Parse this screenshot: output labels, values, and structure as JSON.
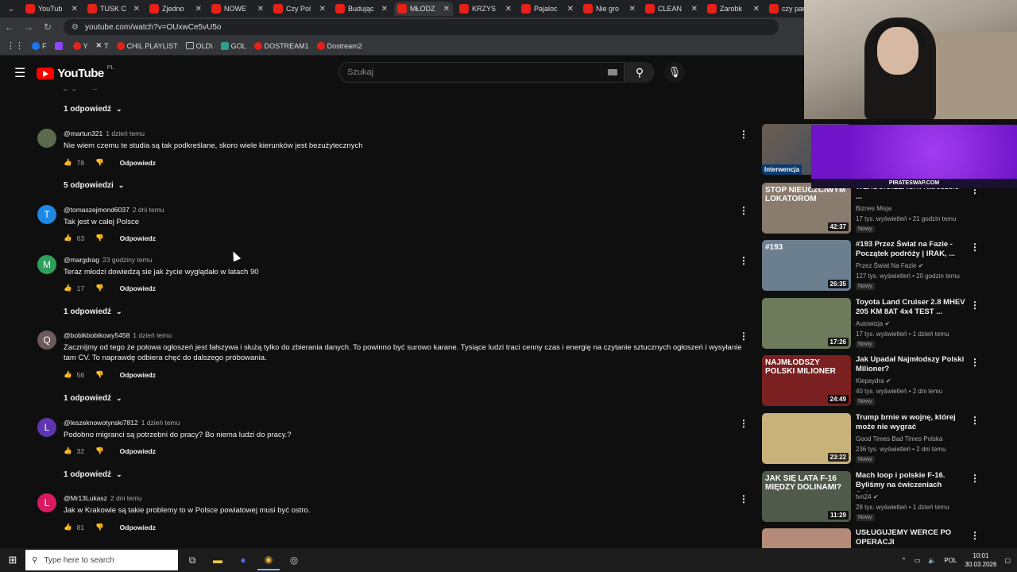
{
  "browser": {
    "tabs": [
      {
        "label": "YouTub",
        "active": false
      },
      {
        "label": "TUSK C",
        "active": false
      },
      {
        "label": "Zjedno",
        "active": false
      },
      {
        "label": "NOWE",
        "active": false
      },
      {
        "label": "Czy Pol",
        "active": false
      },
      {
        "label": "Budując",
        "active": false
      },
      {
        "label": "MŁODZ",
        "active": true
      },
      {
        "label": "KRZYS",
        "active": false
      },
      {
        "label": "Pajaloc",
        "active": false
      },
      {
        "label": "Nie gro",
        "active": false
      },
      {
        "label": "CLEAN",
        "active": false
      },
      {
        "label": "Zarobk",
        "active": false
      },
      {
        "label": "czy par",
        "active": false
      }
    ],
    "url": "youtube.com/watch?v=OUxwCe5vU5o",
    "bookmarks": [
      "F",
      "",
      "Y",
      "T",
      "CHIL PLAYLIST",
      "OLD\\",
      "GOL",
      "DOSTREAM1",
      "Dostream2"
    ]
  },
  "youtube": {
    "logo_text": "YouTube",
    "region": "PL",
    "search_placeholder": "Szukaj"
  },
  "comments": [
    {
      "replies_label": "1 odpowiedź"
    },
    {
      "initial": "",
      "avatar_color": "#5b6a4c",
      "author": "@martun321",
      "when": "1 dzień temu",
      "text": "Nie wiem czemu te studia są tak podkreślane, skoro wiele kierunków jest bezużytecznych",
      "likes": "78",
      "reply_label": "Odpowiedz",
      "replies_label": "5 odpowiedzi"
    },
    {
      "initial": "T",
      "avatar_color": "#1e88e5",
      "author": "@tomaszejmond6037",
      "when": "2 dni temu",
      "text": "Tak jest w całej Polsce",
      "likes": "63",
      "reply_label": "Odpowiedz",
      "replies_label": ""
    },
    {
      "initial": "M",
      "avatar_color": "#2e9e5b",
      "author": "@margdrag",
      "when": "23 godziny temu",
      "text": "Teraz młodzi dowiedzą sie jak życie wyglądało w latach 90",
      "likes": "17",
      "reply_label": "Odpowiedz",
      "replies_label": "1 odpowiedź"
    },
    {
      "initial": "Q",
      "avatar_color": "#6d5a5a",
      "author": "@bobikbobikowy5458",
      "when": "1 dzień temu",
      "text": "Zacznijmy od tego że połowa ogłoszeń jest fałszywa i służą tylko do zbierania danych. To powinno być surowo karane. Tysiące ludzi traci cenny czas i energię na czytanie sztucznych ogłoszeń i wysyłanie tam CV. To naprawdę odbiera chęć do dalszego próbowania.",
      "likes": "56",
      "reply_label": "Odpowiedz",
      "replies_label": "1 odpowiedź"
    },
    {
      "initial": "L",
      "avatar_color": "#5e35b1",
      "author": "@leszeknowotynski7812",
      "when": "1 dzień temu",
      "text": "Podobno migranci są potrzebni do pracy?  Bo niema ludzi do pracy.?",
      "likes": "32",
      "reply_label": "Odpowiedz",
      "replies_label": "1 odpowiedź"
    },
    {
      "initial": "L",
      "avatar_color": "#d81b60",
      "author": "@Mr13Lukasz",
      "when": "2 dni temu",
      "text": "Jak w Krakowie są takie problemy to w Polsce powiatowej musi być ostro.",
      "likes": "81",
      "reply_label": "Odpowiedz",
      "replies_label": ""
    }
  ],
  "sidebar": {
    "partial_label": "Interwencja",
    "overlay_caption": "PIRATESWAP.COM",
    "videos": [
      {
        "title": "WŁAŚCICIELACH! Nareszcie ...",
        "channel": "Biznes Misja",
        "stats": "17 tys. wyświetleń • 21 godzin temu",
        "badge": "Nowy",
        "duration": "42:37",
        "thumb_text": "STOP NIEUCZCIWYM LOKATOROM",
        "thumb_bg": "#8a7b6f",
        "verified": false
      },
      {
        "title": "#193 Przez Świat na Fazie - Początek podróży | IRAK, ...",
        "channel": "Przez Świat Na Fazie",
        "stats": "127 tys. wyświetleń • 20 godzin temu",
        "badge": "Nowy",
        "duration": "26:35",
        "thumb_text": "#193",
        "thumb_bg": "#6b7f8f",
        "verified": true
      },
      {
        "title": "Toyota Land Cruiser 2.8 MHEV 205 KM 8AT 4x4 TEST ...",
        "channel": "Autowizja",
        "stats": "17 tys. wyświetleń • 1 dzień temu",
        "badge": "Nowy",
        "duration": "17:26",
        "thumb_text": "",
        "thumb_bg": "#6d7a5c",
        "verified": true
      },
      {
        "title": "Jak Upadał Najmłodszy Polski Milioner?",
        "channel": "Klepsydra",
        "stats": "40 tys. wyświetleń • 2 dni temu",
        "badge": "Nowy",
        "duration": "24:49",
        "thumb_text": "NAJMŁODSZY POLSKI MILIONER",
        "thumb_bg": "#7a2020",
        "verified": true
      },
      {
        "title": "Trump brnie w wojnę, której może nie wygrać",
        "channel": "Good Times Bad Times Polska",
        "stats": "236 tys. wyświetleń • 2 dni temu",
        "badge": "Nowy",
        "duration": "23:22",
        "thumb_text": "",
        "thumb_bg": "#c8b27a",
        "verified": false
      },
      {
        "title": "Mach loop i polskie F-16. Byliśmy na ćwiczeniach Cobra...",
        "channel": "tvn24",
        "stats": "28 tys. wyświetleń • 1 dzień temu",
        "badge": "Nowy",
        "duration": "11:29",
        "thumb_text": "JAK SIĘ LATA F-16 MIĘDZY DOLINAMI?",
        "thumb_bg": "#4f5a4a",
        "verified": true
      },
      {
        "title": "USŁUGUJEMY WERCE PO OPERACJI",
        "channel": "",
        "stats": "",
        "badge": "",
        "duration": "",
        "thumb_text": "",
        "thumb_bg": "#b48a78",
        "verified": false
      }
    ]
  },
  "taskbar": {
    "search_placeholder": "Type here to search",
    "language": "POL",
    "time": "10:01",
    "date": "30.03.2026"
  }
}
